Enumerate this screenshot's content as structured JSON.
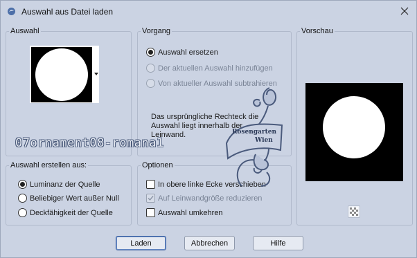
{
  "window": {
    "title": "Auswahl aus Datei laden"
  },
  "auswahl_group": {
    "title": "Auswahl"
  },
  "vorgang_group": {
    "title": "Vorgang",
    "options": [
      {
        "label": "Auswahl ersetzen",
        "checked": true,
        "enabled": true
      },
      {
        "label": "Der aktuellen Auswahl hinzufügen",
        "checked": false,
        "enabled": false
      },
      {
        "label": "Von aktueller Auswahl subtrahieren",
        "checked": false,
        "enabled": false
      }
    ],
    "info_text": "Das ursprüngliche Rechteck die Auswahl liegt innerhalb der Leinwand."
  },
  "vorschau_group": {
    "title": "Vorschau"
  },
  "erstellen_group": {
    "title": "Auswahl erstellen aus:",
    "options": [
      {
        "label": "Luminanz der Quelle",
        "checked": true
      },
      {
        "label": "Beliebiger Wert außer Null",
        "checked": false
      },
      {
        "label": "Deckfähigkeit der Quelle",
        "checked": false
      }
    ]
  },
  "optionen_group": {
    "title": "Optionen",
    "options": [
      {
        "label": "In obere linke Ecke verschieben",
        "checked": false,
        "enabled": true
      },
      {
        "label": "Auf Leinwandgröße reduzieren",
        "checked": false,
        "enabled": false
      },
      {
        "label": "Auswahl umkehren",
        "checked": false,
        "enabled": true
      }
    ]
  },
  "buttons": {
    "ok": "Laden",
    "cancel": "Abbrechen",
    "help": "Hilfe"
  },
  "watermark": {
    "text": "07ornament08-romana1",
    "logo_line1": "Rosengarten",
    "logo_line2": "Wien"
  }
}
